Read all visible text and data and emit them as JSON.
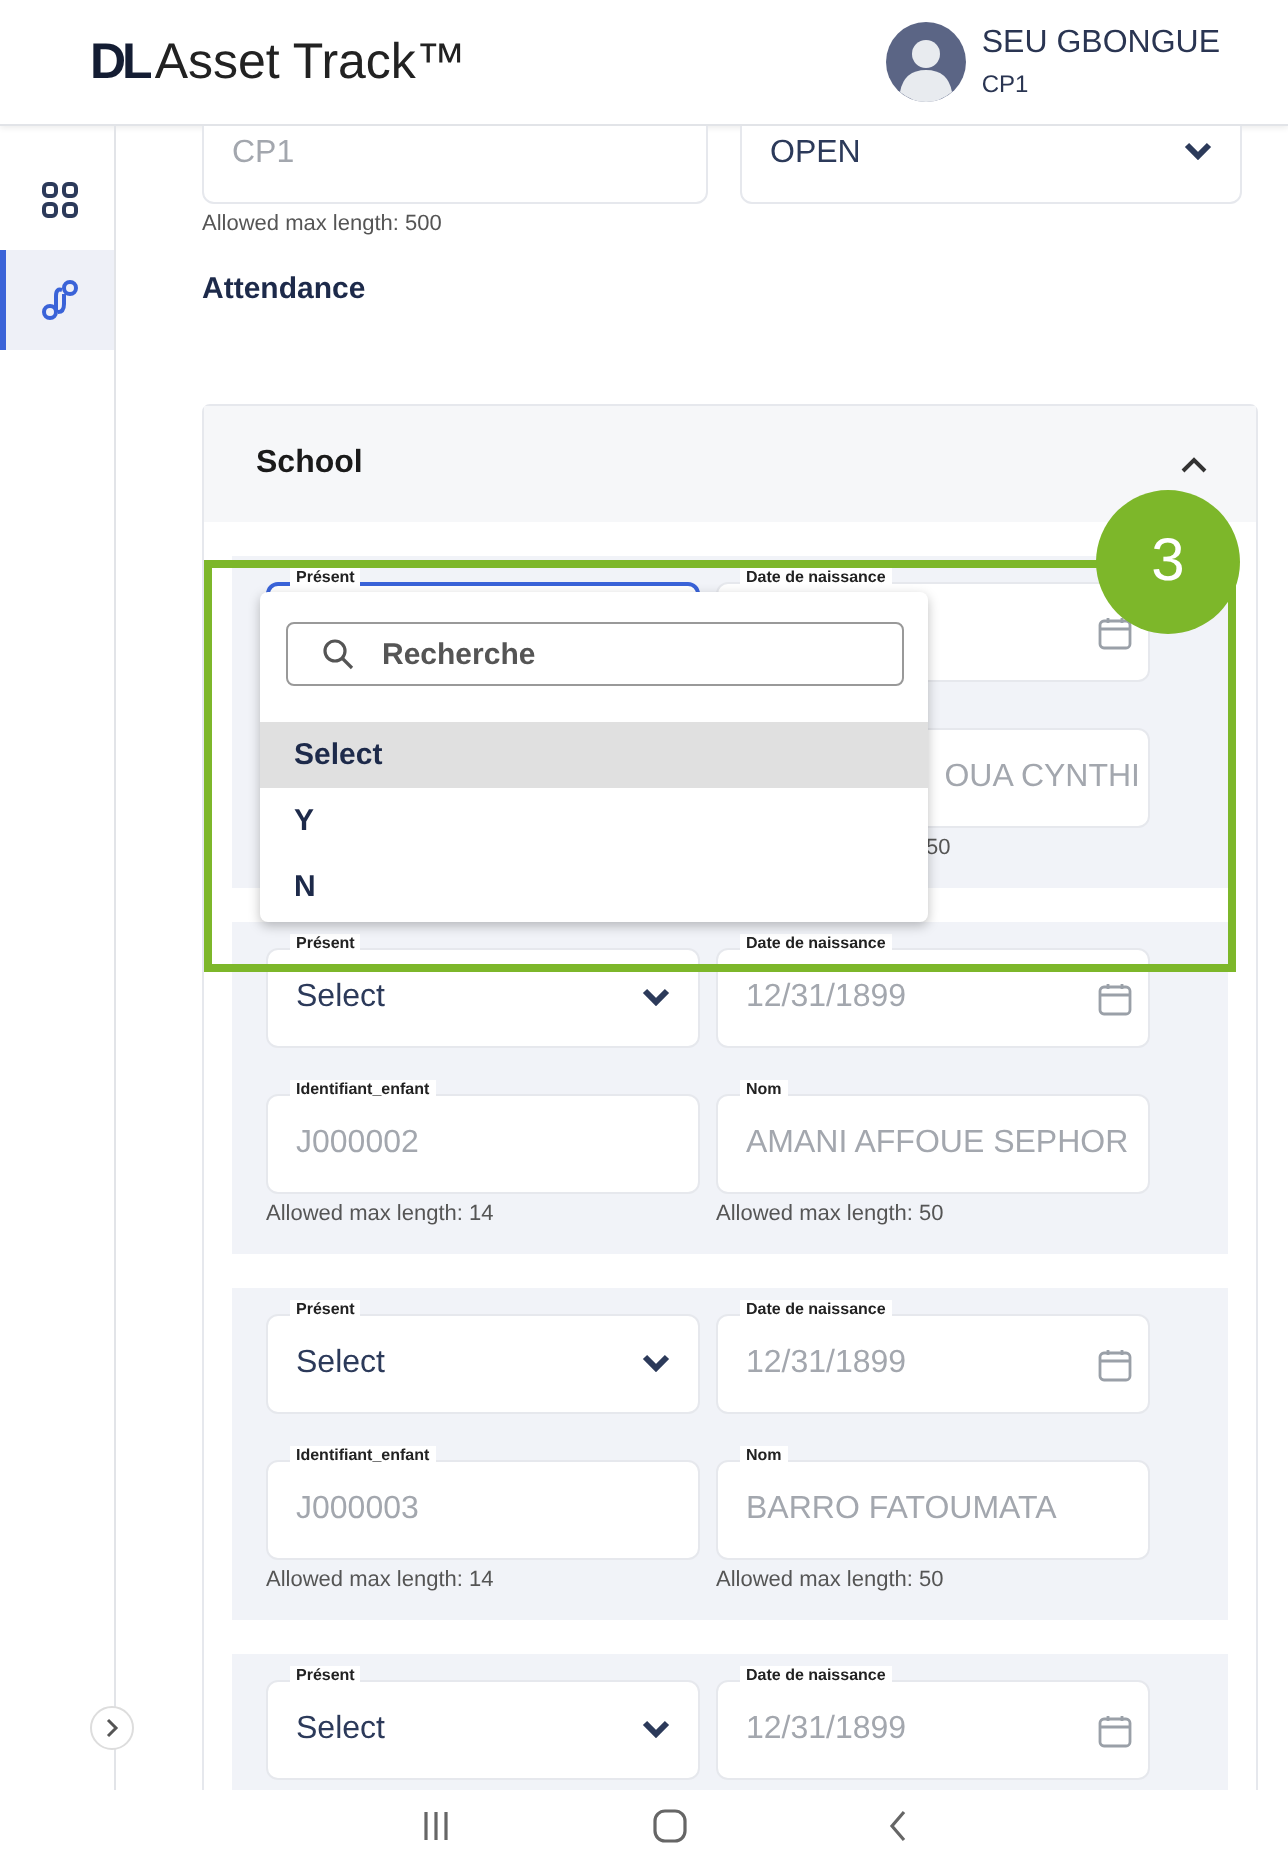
{
  "app": {
    "logo_mark": "DL",
    "logo_text": "Asset Track™"
  },
  "user": {
    "name": "SEU GBONGUE",
    "role": "CP1"
  },
  "sidebar": {
    "items": [
      {
        "kind": "grid",
        "selected": false
      },
      {
        "kind": "route",
        "selected": true
      }
    ]
  },
  "top_fields": [
    {
      "kind": "text",
      "value": "CP1",
      "hint": "Allowed max length: 500"
    },
    {
      "kind": "select",
      "value": "OPEN"
    }
  ],
  "section_title": "Attendance",
  "panel": {
    "title": "School",
    "expanded": true,
    "records": [
      {
        "kind": "covered",
        "fields": [
          {
            "kind": "select",
            "label": "Présent",
            "focused": true
          },
          {
            "kind": "date",
            "label": "Date de naissance"
          },
          {
            "kind": "text",
            "value": "OUA CYNTHI",
            "hint": "50"
          }
        ]
      },
      {
        "kind": "full",
        "fields": [
          {
            "kind": "select",
            "label": "Présent",
            "value": "Select",
            "focused": false
          },
          {
            "kind": "date",
            "label": "Date de naissance",
            "value": "12/31/1899"
          },
          {
            "kind": "text",
            "label": "Identifiant_enfant",
            "value": "J000002",
            "hint": "Allowed max length: 14"
          },
          {
            "kind": "text",
            "label": "Nom",
            "value": "AMANI AFFOUE SEPHOR",
            "hint": "Allowed max length: 50"
          }
        ]
      },
      {
        "kind": "full",
        "fields": [
          {
            "kind": "select",
            "label": "Présent",
            "value": "Select",
            "focused": false
          },
          {
            "kind": "date",
            "label": "Date de naissance",
            "value": "12/31/1899"
          },
          {
            "kind": "text",
            "label": "Identifiant_enfant",
            "value": "J000003",
            "hint": "Allowed max length: 14"
          },
          {
            "kind": "text",
            "label": "Nom",
            "value": "BARRO FATOUMATA",
            "hint": "Allowed max length: 50"
          }
        ]
      },
      {
        "kind": "full",
        "fields": [
          {
            "kind": "select",
            "label": "Présent",
            "value": "Select",
            "focused": false
          },
          {
            "kind": "date",
            "label": "Date de naissance",
            "value": "12/31/1899"
          }
        ]
      }
    ]
  },
  "dropdown": {
    "placeholder": "Recherche",
    "options": [
      {
        "label": "Select",
        "selected": true
      },
      {
        "label": "Y",
        "selected": false
      },
      {
        "label": "N",
        "selected": false
      }
    ]
  },
  "annotation": {
    "label": "3"
  }
}
